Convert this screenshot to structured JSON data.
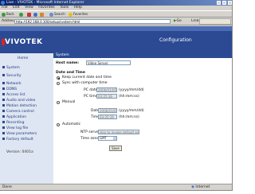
{
  "window": {
    "title": "Live - VIVOTEK - Microsoft Internet Explorer"
  },
  "menubar": [
    "File",
    "Edit",
    "View",
    "Favorites",
    "Tools",
    "Help"
  ],
  "toolbar": {
    "back_label": "Back",
    "forward_label": "",
    "stop_label": "",
    "refresh_label": "",
    "home_label": "",
    "search_label": "Search",
    "favorites_label": "Favorites"
  },
  "address": {
    "label": "Address",
    "value": "http://192.168.0.100/setup/system.html",
    "go_label": "Go",
    "links_label": "Links"
  },
  "banner": {
    "logo_text": "VIVOTEK",
    "config_label": "Configuration"
  },
  "sidebar": {
    "home_label": "Home",
    "items": [
      "System",
      "Security",
      "Network",
      "DDNS",
      "Access list",
      "Audio and video",
      "Motion detection",
      "Camera control",
      "Application",
      "Recording",
      "View log file",
      "View parameters",
      "Factory default"
    ],
    "version_label": "Version: 0401a"
  },
  "main": {
    "section_label": "System",
    "host_name_label": "Host name:",
    "host_name_value": "Video Server",
    "datetime_label": "Date and Time",
    "keep_label": "Keep current date and time",
    "sync_pc_label": "Sync with computer time",
    "pc_date_label": "PC date",
    "pc_date_value": "2006/01/05",
    "pc_date_hint": "(yyyy/mm/dd)",
    "pc_time_label": "PC time",
    "pc_time_value": "03:25:16",
    "pc_time_hint": "(hh:mm:ss)",
    "manual_label": "Manual",
    "date_label": "Date",
    "date_value": "2006/01/05",
    "date_hint": "(yyyy/mm/dd)",
    "time_label": "Time",
    "time_value": "03:25:16",
    "time_hint": "(hh:mm:ss)",
    "auto_label": "Automatic",
    "ntp_label": "NTP server",
    "ntp_value": "skip to invoke default server",
    "timezone_label": "Time zone",
    "timezone_value": "GMT",
    "save_label": "Save"
  },
  "status": {
    "left": "Done",
    "zone": "Internet"
  }
}
